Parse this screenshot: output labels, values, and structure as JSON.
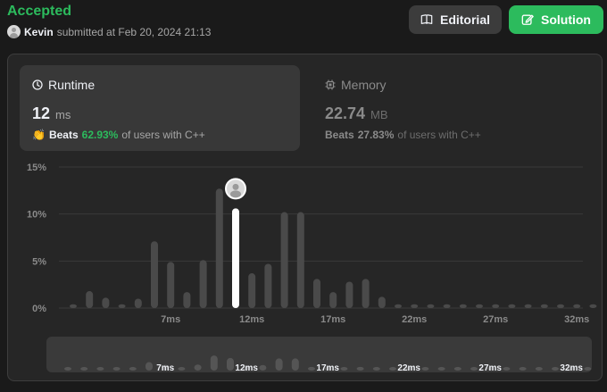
{
  "header": {
    "status": "Accepted",
    "username": "Kevin",
    "submitted_text": "submitted at Feb 20, 2024 21:13",
    "editorial_label": "Editorial",
    "solution_label": "Solution"
  },
  "runtime": {
    "title": "Runtime",
    "value": "12",
    "unit": "ms",
    "beats_word": "Beats",
    "beats_pct": "62.93%",
    "beats_suffix": "of users with C++",
    "icon": "clock-icon"
  },
  "memory": {
    "title": "Memory",
    "value": "22.74",
    "unit": "MB",
    "beats_word": "Beats",
    "beats_pct": "27.83%",
    "beats_suffix": "of users with C++",
    "icon": "chip-icon"
  },
  "colors": {
    "accent": "#2cbb5d",
    "bar": "#4a4a4a",
    "highlight": "#ffffff"
  },
  "chart_data": {
    "type": "bar",
    "y_ticks": [
      "15%",
      "10%",
      "5%",
      "0%"
    ],
    "ylim": [
      0,
      15
    ],
    "x_tick_labels": [
      "7ms",
      "12ms",
      "17ms",
      "22ms",
      "27ms",
      "32ms"
    ],
    "x_tick_values": [
      7,
      12,
      17,
      22,
      27,
      32
    ],
    "x": [
      1,
      2,
      3,
      4,
      5,
      6,
      7,
      8,
      9,
      10,
      11,
      12,
      13,
      14,
      15,
      16,
      17,
      18,
      19,
      20,
      21,
      22,
      23,
      24,
      25,
      26,
      27,
      28,
      29,
      30,
      31,
      32,
      33
    ],
    "values": [
      0.4,
      1.8,
      1.1,
      0.4,
      1.0,
      7.1,
      4.9,
      1.7,
      5.1,
      12.7,
      10.6,
      3.7,
      4.7,
      10.2,
      10.2,
      3.1,
      1.7,
      2.8,
      3.1,
      1.2,
      0.4,
      0.4,
      0.4,
      0.4,
      0.4,
      0.4,
      0.4,
      0.4,
      0.4,
      0.4,
      0.4,
      0.4,
      0.4
    ],
    "highlight_x": 11,
    "grid": true
  }
}
